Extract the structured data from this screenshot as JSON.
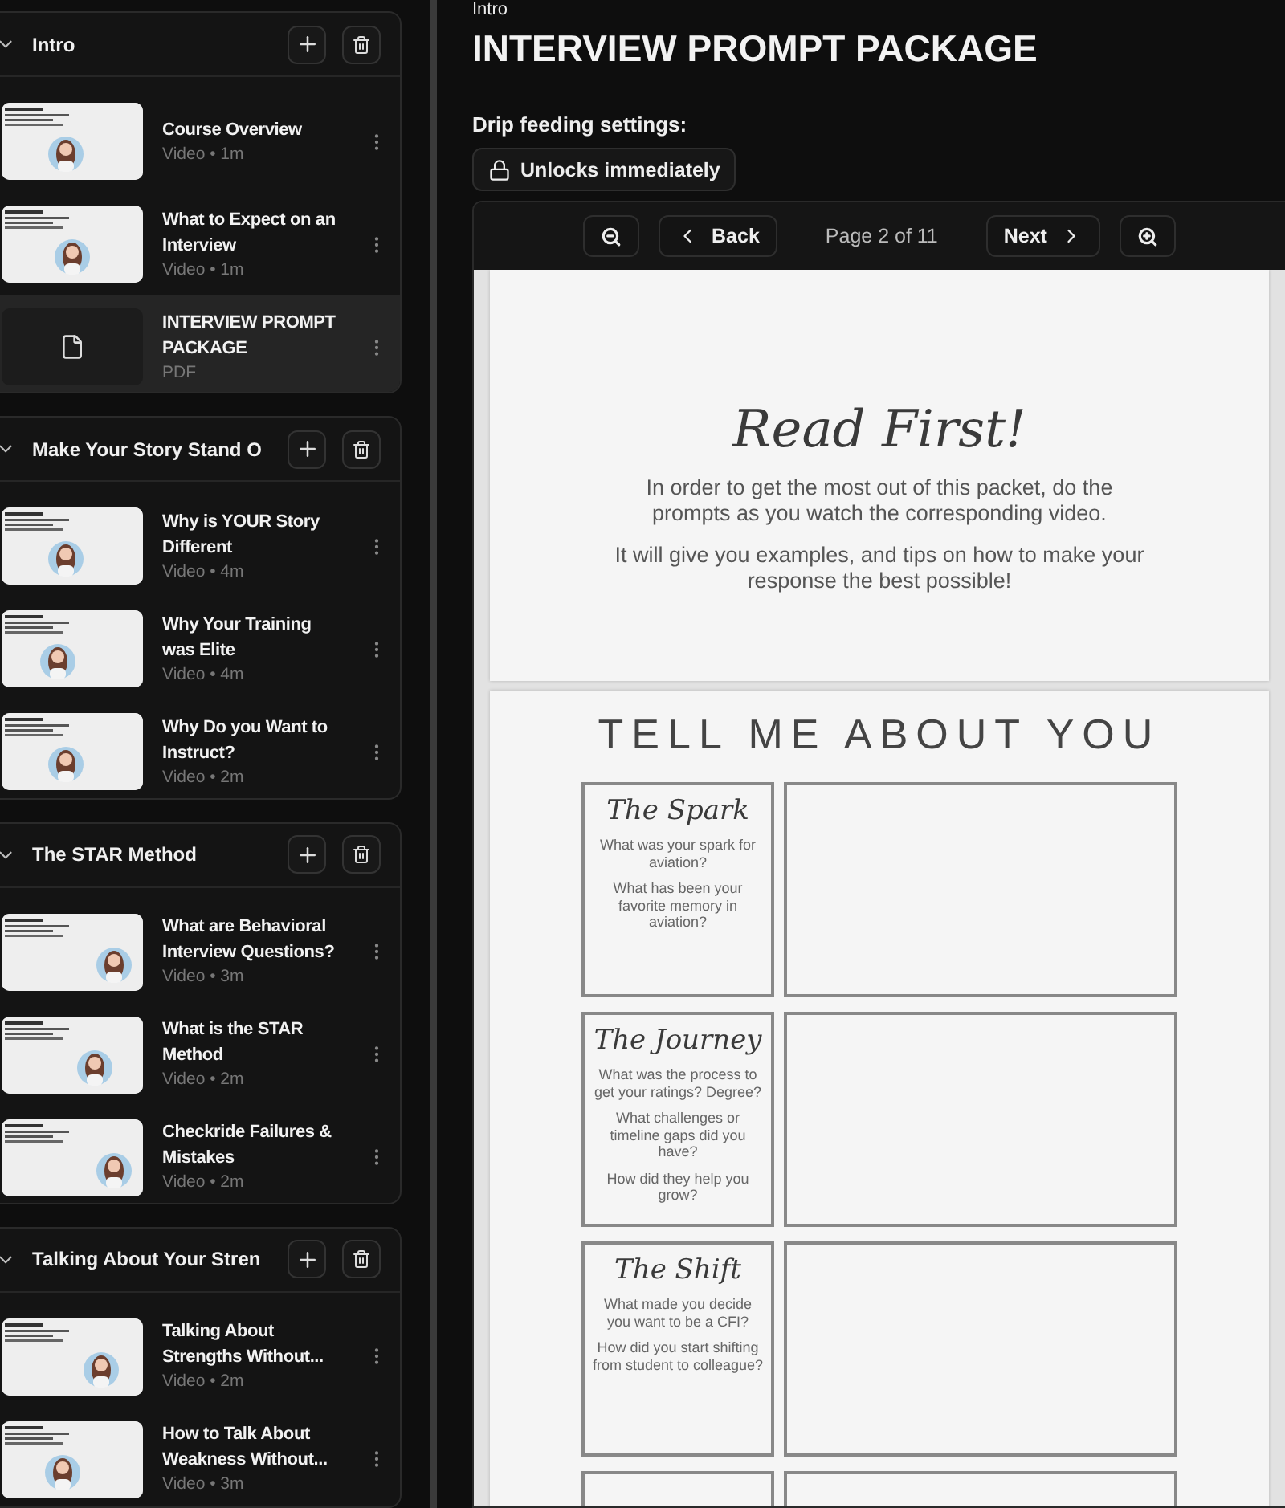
{
  "sidebar": {
    "sections": [
      {
        "title": "Intro",
        "expanded": true,
        "lessons": [
          {
            "title": "Course Overview",
            "meta": "Video • 1m",
            "kind": "video",
            "selected": false
          },
          {
            "title": "What to Expect on an Interview",
            "meta": "Video • 1m",
            "kind": "video",
            "selected": false
          },
          {
            "title": "INTERVIEW PROMPT PACKAGE",
            "meta": "PDF",
            "kind": "pdf",
            "selected": true
          }
        ]
      },
      {
        "title": "Make Your Story Stand O",
        "expanded": true,
        "lessons": [
          {
            "title": "Why is YOUR Story Different",
            "meta": "Video • 4m",
            "kind": "video",
            "selected": false
          },
          {
            "title": "Why Your Training was Elite",
            "meta": "Video • 4m",
            "kind": "video",
            "selected": false
          },
          {
            "title": "Why Do you Want to Instruct?",
            "meta": "Video • 2m",
            "kind": "video",
            "selected": false
          }
        ]
      },
      {
        "title": "The STAR Method",
        "expanded": true,
        "lessons": [
          {
            "title": "What are Behavioral Interview Questions?",
            "meta": "Video • 3m",
            "kind": "video",
            "selected": false
          },
          {
            "title": "What is the STAR Method",
            "meta": "Video • 2m",
            "kind": "video",
            "selected": false
          },
          {
            "title": "Checkride Failures & Mistakes",
            "meta": "Video • 2m",
            "kind": "video",
            "selected": false
          }
        ]
      },
      {
        "title": "Talking About Your Stren",
        "expanded": true,
        "lessons": [
          {
            "title": "Talking About Strengths Without...",
            "meta": "Video • 2m",
            "kind": "video",
            "selected": false
          },
          {
            "title": "How to Talk About Weakness Without...",
            "meta": "Video • 3m",
            "kind": "video",
            "selected": false
          }
        ]
      }
    ]
  },
  "main": {
    "breadcrumb": "Intro",
    "title": "INTERVIEW PROMPT PACKAGE",
    "drip_label": "Drip feeding settings:",
    "drip_button": "Unlocks immediately",
    "viewer": {
      "back": "Back",
      "next": "Next",
      "page_indicator": "Page 2 of 11",
      "intro_page": {
        "heading": "Read First!",
        "paragraphs": [
          "In order to get the most out of this packet, do the prompts as you watch the corresponding video.",
          "It will give you examples, and tips on how to make your response the best possible!"
        ]
      },
      "prompt_page": {
        "heading": "TELL ME ABOUT YOU",
        "prompts": [
          {
            "title": "The Spark",
            "questions": [
              "What was your spark for aviation?",
              "What has been your favorite memory in aviation?"
            ]
          },
          {
            "title": "The Journey",
            "questions": [
              "What was the process to get your ratings? Degree?",
              "What challenges or timeline gaps did you have?",
              "How did they help you grow?"
            ]
          },
          {
            "title": "The Shift",
            "questions": [
              "What made you decide you want to be a CFI?",
              "How did you start shifting from student to colleague?"
            ]
          }
        ]
      }
    }
  }
}
